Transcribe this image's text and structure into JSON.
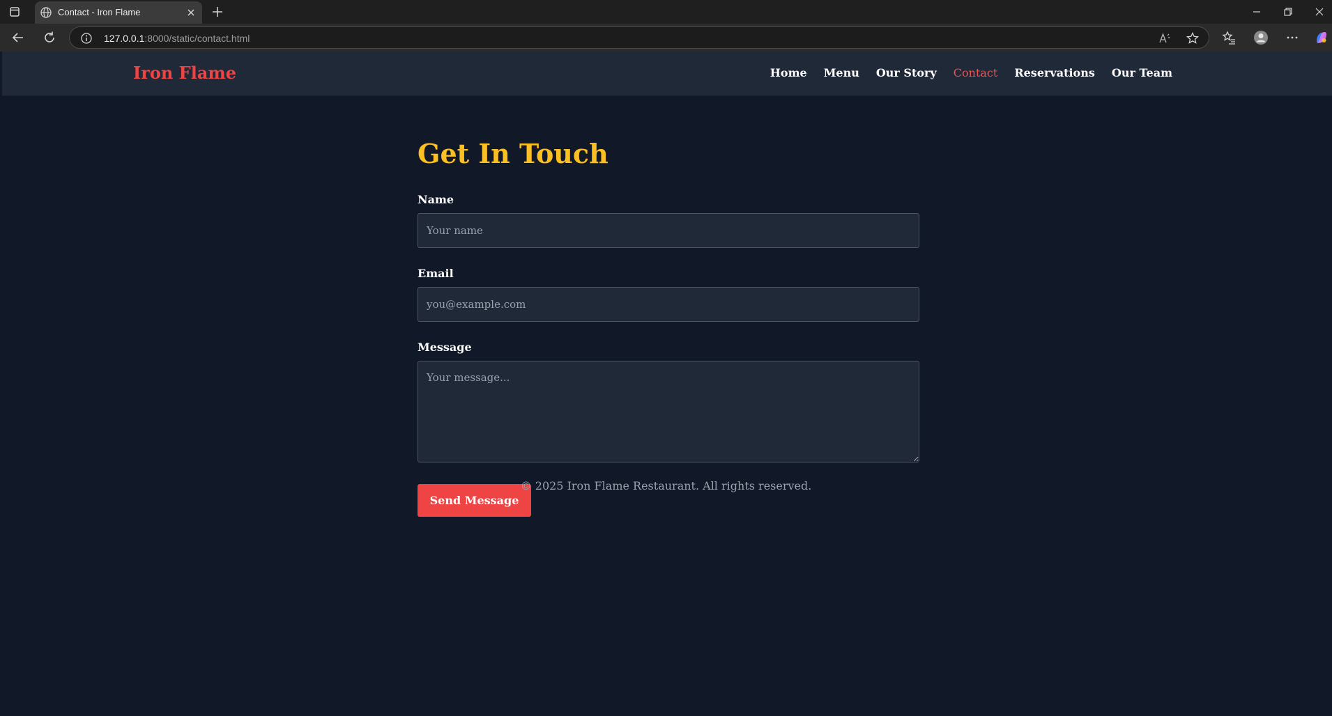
{
  "browser": {
    "tab_title": "Contact - Iron Flame",
    "url_host": "127.0.0.1",
    "url_rest": ":8000/static/contact.html"
  },
  "site": {
    "brand": "Iron Flame",
    "nav": [
      {
        "label": "Home",
        "active": false
      },
      {
        "label": "Menu",
        "active": false
      },
      {
        "label": "Our Story",
        "active": false
      },
      {
        "label": "Contact",
        "active": true
      },
      {
        "label": "Reservations",
        "active": false
      },
      {
        "label": "Our Team",
        "active": false
      }
    ]
  },
  "contact": {
    "title": "Get In Touch",
    "name_label": "Name",
    "name_placeholder": "Your name",
    "email_label": "Email",
    "email_placeholder": "you@example.com",
    "message_label": "Message",
    "message_placeholder": "Your message...",
    "submit_label": "Send Message"
  },
  "footer": {
    "text": "© 2025 Iron Flame Restaurant. All rights reserved."
  },
  "colors": {
    "page_bg": "#111827",
    "header_bg": "#1f2937",
    "brand": "#ef4444",
    "title": "#fbbf24",
    "active_nav": "#f05252"
  },
  "icons": [
    "sidebar-toggle-icon",
    "globe-icon",
    "close-icon",
    "plus-icon",
    "back-arrow-icon",
    "refresh-icon",
    "info-icon",
    "read-aloud-icon",
    "star-icon",
    "favorites-icon",
    "profile-icon",
    "more-icon",
    "copilot-icon",
    "minimize-icon",
    "restore-icon"
  ]
}
